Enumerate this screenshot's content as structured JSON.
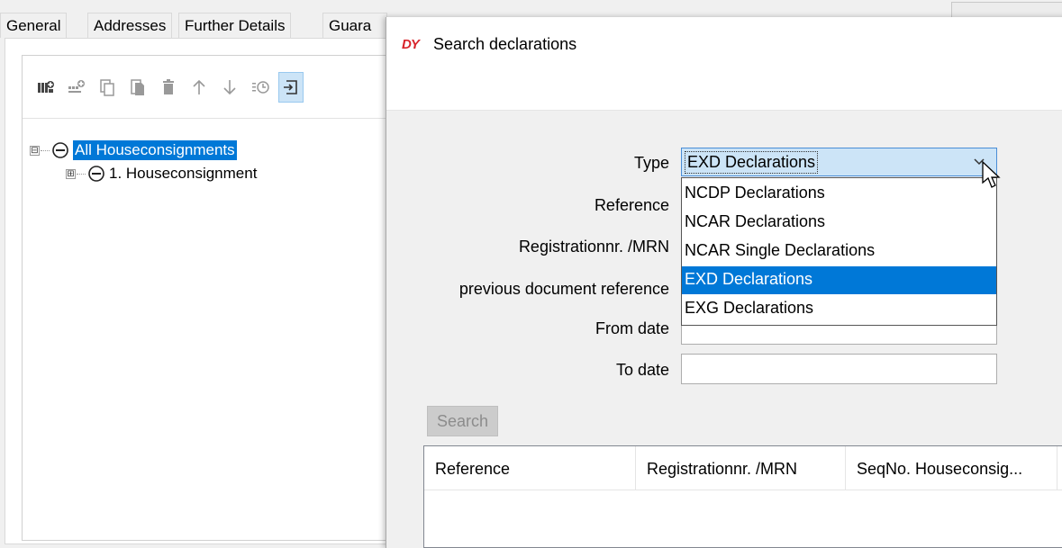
{
  "tabs": [
    {
      "label": "General"
    },
    {
      "label": "Addresses"
    },
    {
      "label": "Further Details"
    },
    {
      "label": "Guara"
    }
  ],
  "toolbar": {
    "buttons": [
      {
        "icon": "add-consignment-icon"
      },
      {
        "icon": "add-item-icon"
      },
      {
        "icon": "copy-icon"
      },
      {
        "icon": "paste-icon"
      },
      {
        "icon": "delete-icon"
      },
      {
        "icon": "arrow-up-icon"
      },
      {
        "icon": "arrow-down-icon"
      },
      {
        "icon": "history-icon"
      },
      {
        "icon": "import-icon"
      }
    ]
  },
  "tree": {
    "root": {
      "label": "All Houseconsignments",
      "expander": "⊟"
    },
    "child": {
      "label": "1. Houseconsignment",
      "expander": "⊞"
    }
  },
  "dialog": {
    "logo": "DY",
    "title": "Search declarations",
    "labels": {
      "type": "Type",
      "reference": "Reference",
      "registration": "Registrationnr. /MRN",
      "previous_reference": "previous document reference",
      "from_date": "From date",
      "to_date": "To date"
    },
    "type_select": {
      "selected": "EXD Declarations",
      "options": [
        "NCDP Declarations",
        "NCAR Declarations",
        "NCAR Single Declarations",
        "EXD Declarations",
        "EXG Declarations"
      ],
      "highlighted_index": 3
    },
    "inputs": {
      "reference": "",
      "registration": "",
      "previous_reference": "",
      "from_date": "",
      "to_date": ""
    },
    "search_button": "Search",
    "grid": {
      "columns": [
        "Reference",
        "Registrationnr. /MRN",
        "SeqNo. Houseconsig..."
      ]
    }
  }
}
